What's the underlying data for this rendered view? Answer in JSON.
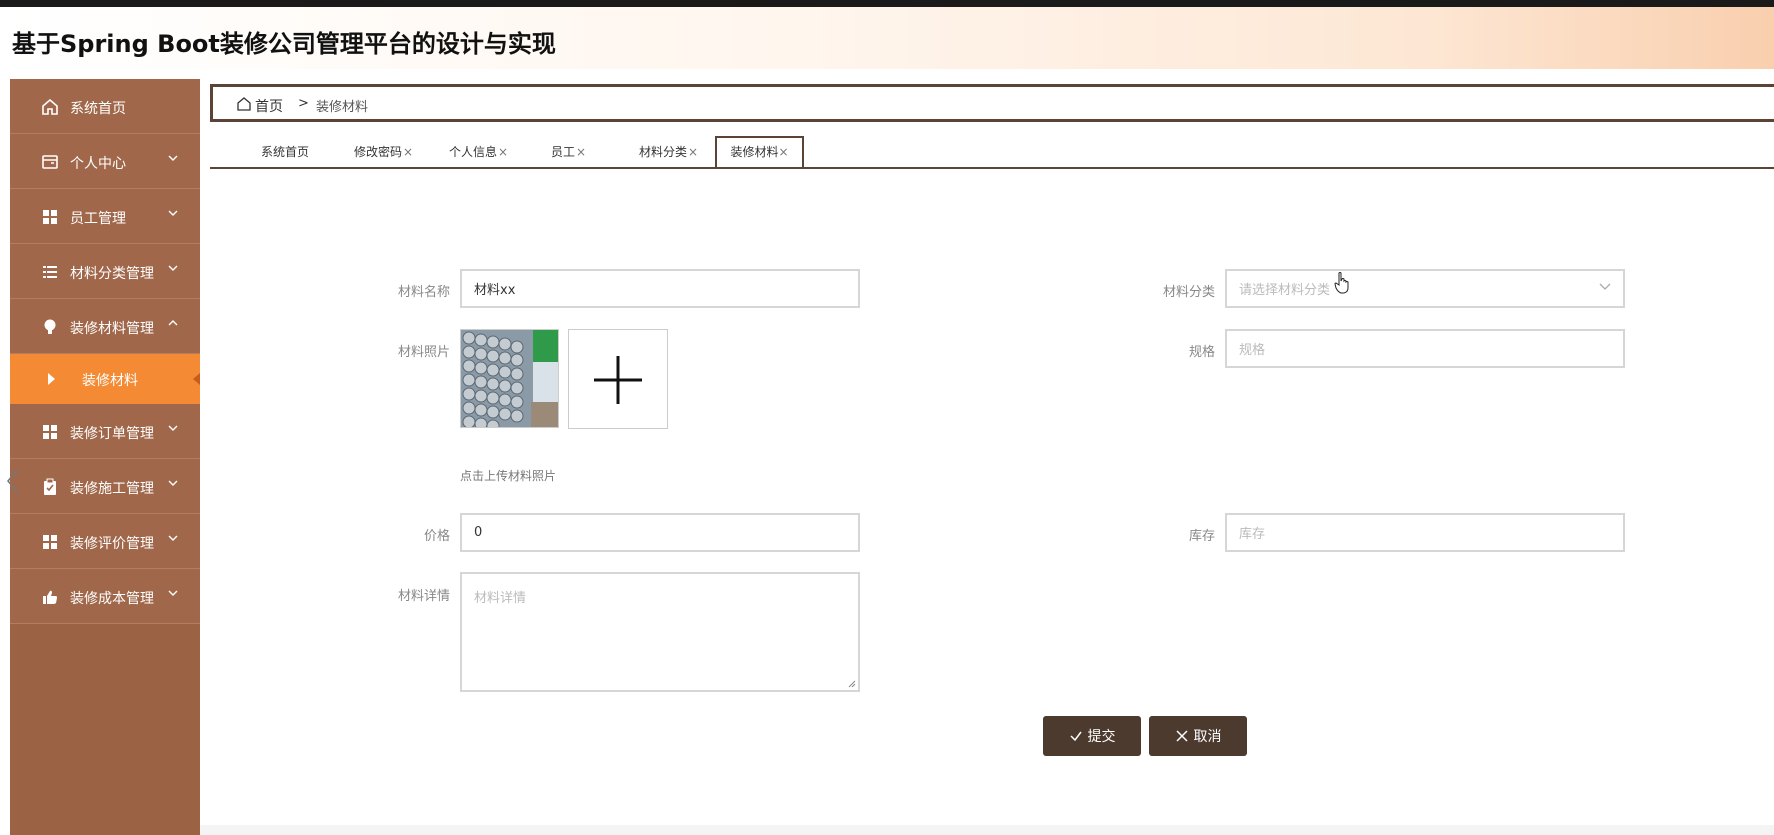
{
  "app": {
    "title": "基于Spring Boot装修公司管理平台的设计与实现"
  },
  "sidebar": {
    "items": [
      {
        "label": "系统首页",
        "icon": "home-icon"
      },
      {
        "label": "个人中心",
        "icon": "wallet-icon"
      },
      {
        "label": "员工管理",
        "icon": "grid-icon"
      },
      {
        "label": "材料分类管理",
        "icon": "list-icon"
      },
      {
        "label": "装修材料管理",
        "icon": "bulb-icon"
      },
      {
        "label": "装修订单管理",
        "icon": "grid-icon"
      },
      {
        "label": "装修施工管理",
        "icon": "clipboard-icon"
      },
      {
        "label": "装修评价管理",
        "icon": "grid-icon"
      },
      {
        "label": "装修成本管理",
        "icon": "thumbs-up-icon"
      }
    ],
    "sub_items": [
      {
        "label": "装修材料",
        "active": true
      }
    ]
  },
  "breadcrumb": {
    "home": "首页",
    "separator": ">",
    "current": "装修材料"
  },
  "tabs": [
    {
      "label": "系统首页",
      "closable": false
    },
    {
      "label": "修改密码",
      "closable": true
    },
    {
      "label": "个人信息",
      "closable": true
    },
    {
      "label": "员工",
      "closable": true
    },
    {
      "label": "材料分类",
      "closable": true
    },
    {
      "label": "装修材料",
      "closable": true,
      "active": true
    }
  ],
  "tab_close_glyph": "×",
  "form": {
    "name": {
      "label": "材料名称",
      "value": "材料xx"
    },
    "category": {
      "label": "材料分类",
      "placeholder": "请选择材料分类"
    },
    "photo": {
      "label": "材料照片",
      "hint": "点击上传材料照片"
    },
    "spec": {
      "label": "规格",
      "placeholder": "规格"
    },
    "price": {
      "label": "价格",
      "value": "0"
    },
    "stock": {
      "label": "库存",
      "placeholder": "库存"
    },
    "detail": {
      "label": "材料详情",
      "placeholder": "材料详情"
    }
  },
  "buttons": {
    "submit": "提交",
    "cancel": "取消"
  },
  "colors": {
    "sidebar_bg": "#a0674a",
    "sidebar_active": "#f48a33",
    "accent_dark": "#5b4435",
    "button_bg": "#4d3a2f"
  }
}
